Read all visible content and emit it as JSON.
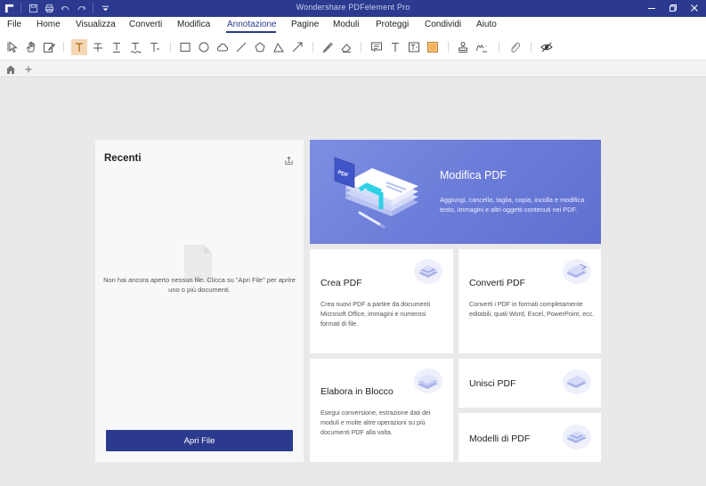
{
  "window": {
    "title": "Wondershare PDFelement Pro"
  },
  "menu": [
    "File",
    "Home",
    "Visualizza",
    "Converti",
    "Modifica",
    "Annotazione",
    "Pagine",
    "Moduli",
    "Proteggi",
    "Condividi",
    "Aiuto"
  ],
  "active_menu": "Annotazione",
  "recent": {
    "title": "Recenti",
    "empty_message": "Non hai ancora aperto nessun file. Clicca su \"Apri File\" per aprire uno o più documenti.",
    "open_button": "Apri File"
  },
  "hero": {
    "title": "Modifica PDF",
    "description": "Aggiungi, cancella, taglia, copia, incolla e modifica testo, immagini e altri oggetti contenuti nei PDF.",
    "badge": "PDF"
  },
  "cards": {
    "create": {
      "title": "Crea PDF",
      "description": "Crea nuovi PDF a partire da documenti Microsoft Office, immagini e numerosi formati di file."
    },
    "convert": {
      "title": "Converti PDF",
      "description": "Converti i PDF in formati completamente editabili, quali Word, Excel, PowerPoint, ecc."
    },
    "batch": {
      "title": "Elabora in Blocco",
      "description": "Esegui conversione, estrazione dati dei moduli e molte altre operazioni su più documenti PDF alla volta."
    },
    "merge": {
      "title": "Unisci PDF"
    },
    "templates": {
      "title": "Modelli di PDF"
    }
  },
  "colors": {
    "titlebar": "#2b3a8f",
    "accent": "#2c3a8e",
    "hero": "#6a7bd8",
    "background": "#e9e9e9"
  }
}
